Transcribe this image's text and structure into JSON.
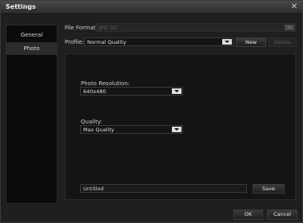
{
  "window": {
    "title": "Settings",
    "close_symbol": "✕"
  },
  "sidebar": {
    "items": [
      {
        "label": "General"
      },
      {
        "label": "Photo"
      }
    ]
  },
  "format": {
    "label": "File Format:",
    "value": "JPG 3D"
  },
  "profile": {
    "label": "Profile:",
    "value": "Normal Quality",
    "new_label": "New",
    "delete_label": "Delete"
  },
  "resolution": {
    "label": "Photo Resolution:",
    "value": "640x480"
  },
  "quality": {
    "label": "Quality:",
    "value": "Max Quality"
  },
  "save_name": {
    "value": "Untitled",
    "save_label": "Save"
  },
  "footer": {
    "ok_label": "OK",
    "cancel_label": "Cancel"
  }
}
